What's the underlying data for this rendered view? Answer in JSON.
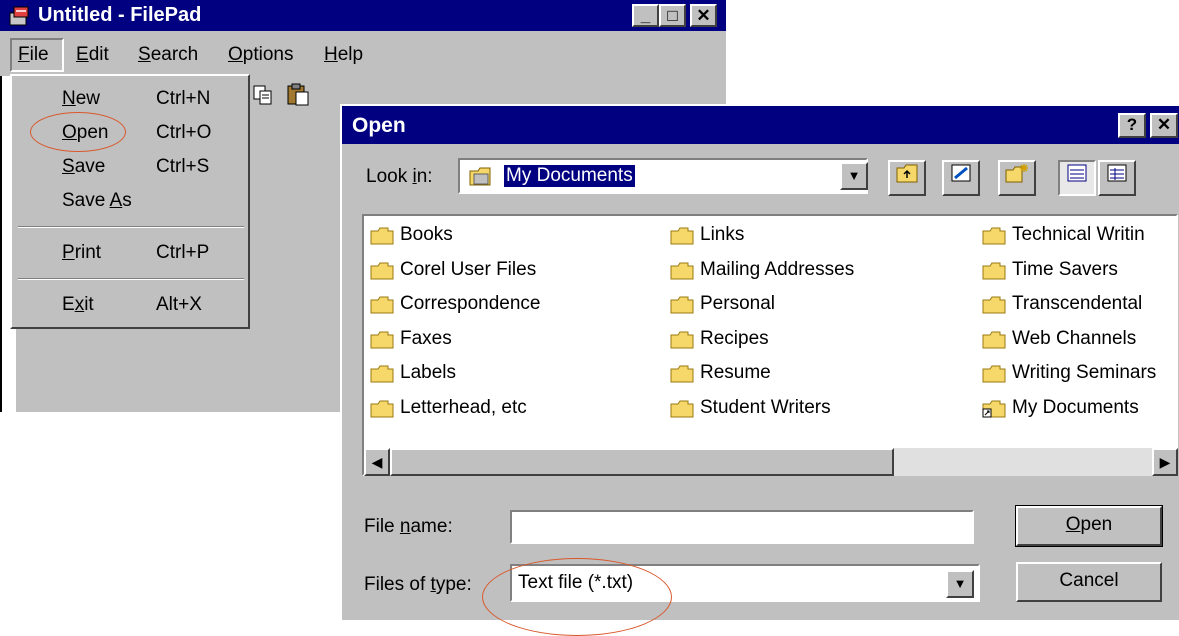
{
  "filepad": {
    "title": "Untitled - FilePad",
    "minimize_glyph": "_",
    "maximize_glyph": "□",
    "close_glyph": "✕",
    "menubar": [
      {
        "label": "File",
        "mnemonic": "F",
        "rest": "ile"
      },
      {
        "label": "Edit",
        "mnemonic": "E",
        "rest": "dit"
      },
      {
        "label": "Search",
        "mnemonic": "S",
        "rest": "earch"
      },
      {
        "label": "Options",
        "mnemonic": "O",
        "rest": "ptions"
      },
      {
        "label": "Help",
        "mnemonic": "H",
        "rest": "elp"
      }
    ],
    "toolbar_icons": [
      "copy-icon",
      "paste-icon",
      "undo-icon",
      "find-icon",
      "help-icon"
    ]
  },
  "file_menu": {
    "items": [
      {
        "label": "New",
        "mnemonic": "N",
        "rest": "ew",
        "shortcut": "Ctrl+N"
      },
      {
        "label": "Open",
        "mnemonic": "O",
        "rest": "pen",
        "shortcut": "Ctrl+O"
      },
      {
        "label": "Save",
        "mnemonic": "S",
        "rest": "ave",
        "shortcut": "Ctrl+S"
      },
      {
        "label": "Save As",
        "pre": "Save ",
        "mnemonic": "A",
        "rest": "s",
        "shortcut": ""
      },
      {
        "label": "Print",
        "mnemonic": "P",
        "rest": "rint",
        "shortcut": "Ctrl+P"
      },
      {
        "label": "Exit",
        "pre": "E",
        "mnemonic": "x",
        "rest": "it",
        "shortcut": "Alt+X"
      }
    ]
  },
  "open_dialog": {
    "title": "Open",
    "help_glyph": "?",
    "close_glyph": "✕",
    "look_in": {
      "label_pre": "Look ",
      "label_mnemonic": "i",
      "label_rest": "n:",
      "value": "My Documents"
    },
    "toolbar_icons": [
      "up-one-level-icon",
      "desktop-icon",
      "new-folder-icon",
      "list-view-icon",
      "details-view-icon"
    ],
    "columns": [
      [
        "Books",
        "Corel User Files",
        "Correspondence",
        "Faxes",
        "Labels",
        "Letterhead, etc"
      ],
      [
        "Links",
        "Mailing Addresses",
        "Personal",
        "Recipes",
        "Resume",
        "Student Writers"
      ],
      [
        "Technical Writin",
        "Time Savers",
        "Transcendental",
        "Web Channels",
        "Writing Seminars",
        "My Documents"
      ]
    ],
    "file_name": {
      "label_pre": "File ",
      "label_mnemonic": "n",
      "label_rest": "ame:",
      "value": ""
    },
    "file_type": {
      "label_pre": "Files of ",
      "label_mnemonic": "t",
      "label_rest": "ype:",
      "value": "Text file (*.txt)"
    },
    "open_button": {
      "mnemonic": "O",
      "rest": "pen"
    },
    "cancel_button": "Cancel",
    "scroll_left_glyph": "◀",
    "scroll_right_glyph": "▶",
    "dropdown_glyph": "▼"
  },
  "colors": {
    "title_bar": "#000080",
    "face": "#c0c0c0",
    "annotation": "#d9582c",
    "folder": "#f5d76a"
  }
}
